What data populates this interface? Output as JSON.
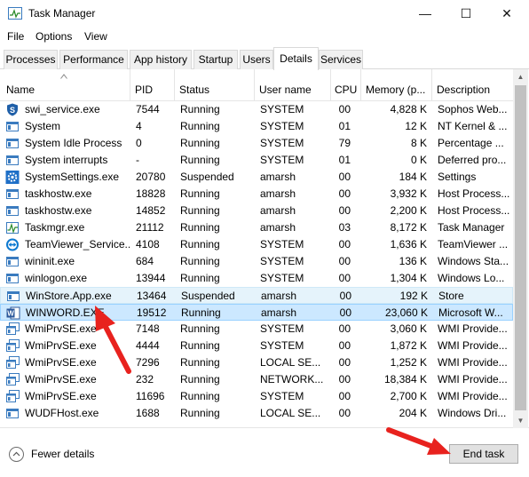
{
  "window": {
    "title": "Task Manager",
    "minimize": "—",
    "maximize": "☐",
    "close": "✕"
  },
  "menu": [
    "File",
    "Options",
    "View"
  ],
  "tabs": [
    "Processes",
    "Performance",
    "App history",
    "Startup",
    "Users",
    "Details",
    "Services"
  ],
  "active_tab": "Details",
  "columns": [
    "Name",
    "PID",
    "Status",
    "User name",
    "CPU",
    "Memory (p...",
    "Description"
  ],
  "rows": [
    {
      "icon": "shield-icon",
      "name": "swi_service.exe",
      "pid": "7544",
      "status": "Running",
      "user": "SYSTEM",
      "cpu": "00",
      "mem": "4,828 K",
      "desc": "Sophos Web..."
    },
    {
      "icon": "app-window-icon",
      "name": "System",
      "pid": "4",
      "status": "Running",
      "user": "SYSTEM",
      "cpu": "01",
      "mem": "12 K",
      "desc": "NT Kernel & ..."
    },
    {
      "icon": "app-window-icon",
      "name": "System Idle Process",
      "pid": "0",
      "status": "Running",
      "user": "SYSTEM",
      "cpu": "79",
      "mem": "8 K",
      "desc": "Percentage ..."
    },
    {
      "icon": "app-window-icon",
      "name": "System interrupts",
      "pid": "-",
      "status": "Running",
      "user": "SYSTEM",
      "cpu": "01",
      "mem": "0 K",
      "desc": "Deferred pro..."
    },
    {
      "icon": "gear-icon",
      "name": "SystemSettings.exe",
      "pid": "20780",
      "status": "Suspended",
      "user": "amarsh",
      "cpu": "00",
      "mem": "184 K",
      "desc": "Settings"
    },
    {
      "icon": "app-window-icon",
      "name": "taskhostw.exe",
      "pid": "18828",
      "status": "Running",
      "user": "amarsh",
      "cpu": "00",
      "mem": "3,932 K",
      "desc": "Host Process..."
    },
    {
      "icon": "app-window-icon",
      "name": "taskhostw.exe",
      "pid": "14852",
      "status": "Running",
      "user": "amarsh",
      "cpu": "00",
      "mem": "2,200 K",
      "desc": "Host Process..."
    },
    {
      "icon": "task-manager-icon",
      "name": "Taskmgr.exe",
      "pid": "21112",
      "status": "Running",
      "user": "amarsh",
      "cpu": "03",
      "mem": "8,172 K",
      "desc": "Task Manager"
    },
    {
      "icon": "teamviewer-icon",
      "name": "TeamViewer_Service....",
      "pid": "4108",
      "status": "Running",
      "user": "SYSTEM",
      "cpu": "00",
      "mem": "1,636 K",
      "desc": "TeamViewer ..."
    },
    {
      "icon": "app-window-icon",
      "name": "wininit.exe",
      "pid": "684",
      "status": "Running",
      "user": "SYSTEM",
      "cpu": "00",
      "mem": "136 K",
      "desc": "Windows Sta..."
    },
    {
      "icon": "app-window-icon",
      "name": "winlogon.exe",
      "pid": "13944",
      "status": "Running",
      "user": "SYSTEM",
      "cpu": "00",
      "mem": "1,304 K",
      "desc": "Windows Lo..."
    },
    {
      "icon": "app-window-icon",
      "name": "WinStore.App.exe",
      "pid": "13464",
      "status": "Suspended",
      "user": "amarsh",
      "cpu": "00",
      "mem": "192 K",
      "desc": "Store"
    },
    {
      "icon": "word-icon",
      "name": "WINWORD.EXE",
      "pid": "19512",
      "status": "Running",
      "user": "amarsh",
      "cpu": "00",
      "mem": "23,060 K",
      "desc": "Microsoft W..."
    },
    {
      "icon": "wmi-icon",
      "name": "WmiPrvSE.exe",
      "pid": "7148",
      "status": "Running",
      "user": "SYSTEM",
      "cpu": "00",
      "mem": "3,060 K",
      "desc": "WMI Provide..."
    },
    {
      "icon": "wmi-icon",
      "name": "WmiPrvSE.exe",
      "pid": "4444",
      "status": "Running",
      "user": "SYSTEM",
      "cpu": "00",
      "mem": "1,872 K",
      "desc": "WMI Provide..."
    },
    {
      "icon": "wmi-icon",
      "name": "WmiPrvSE.exe",
      "pid": "7296",
      "status": "Running",
      "user": "LOCAL SE...",
      "cpu": "00",
      "mem": "1,252 K",
      "desc": "WMI Provide..."
    },
    {
      "icon": "wmi-icon",
      "name": "WmiPrvSE.exe",
      "pid": "232",
      "status": "Running",
      "user": "NETWORK...",
      "cpu": "00",
      "mem": "18,384 K",
      "desc": "WMI Provide..."
    },
    {
      "icon": "wmi-icon",
      "name": "WmiPrvSE.exe",
      "pid": "11696",
      "status": "Running",
      "user": "SYSTEM",
      "cpu": "00",
      "mem": "2,700 K",
      "desc": "WMI Provide..."
    },
    {
      "icon": "app-window-icon",
      "name": "WUDFHost.exe",
      "pid": "1688",
      "status": "Running",
      "user": "LOCAL SE...",
      "cpu": "00",
      "mem": "204 K",
      "desc": "Windows Dri..."
    }
  ],
  "hovered_row": "WinStore.App.exe",
  "selected_row": "WINWORD.EXE",
  "footer": {
    "fewer_details": "Fewer details",
    "end_task": "End task"
  },
  "annotation_color": "#e8221e"
}
